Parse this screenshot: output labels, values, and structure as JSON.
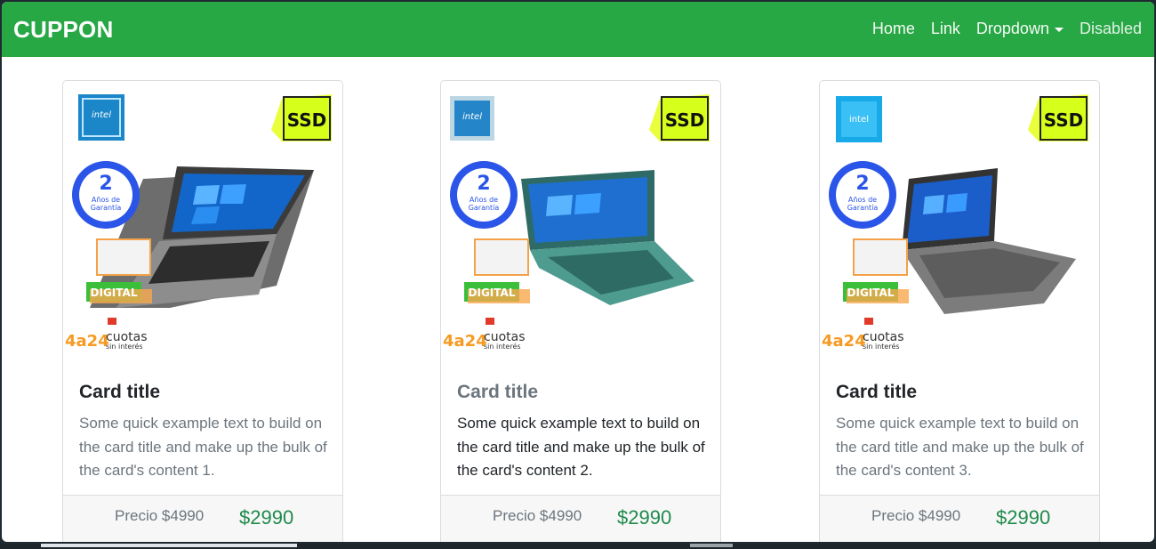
{
  "navbar": {
    "brand": "CUPPON",
    "links": [
      {
        "label": "Home"
      },
      {
        "label": "Link"
      },
      {
        "label": "Dropdown"
      },
      {
        "label": "Disabled"
      }
    ]
  },
  "colors": {
    "navbar": "#28a745",
    "price": "#1f8a4c",
    "muted_text": "#6c757d"
  },
  "cards": [
    {
      "badge_cpu": "intel",
      "badge_ssd": "SSD",
      "warranty_num": "2",
      "warranty_line1": "Años de",
      "warranty_line2": "Garantía",
      "digital": "DIGITAL",
      "cuotas_num": "4a24",
      "cuotas": "cuotas",
      "cuotas_sub": "sin interés",
      "title": "Card title",
      "text": "Some quick example text to build on the card title and make up the bulk of the card's content 1.",
      "price_old": "Precio $4990",
      "price_new": "$2990"
    },
    {
      "badge_cpu": "intel",
      "badge_ssd": "SSD",
      "warranty_num": "2",
      "warranty_line1": "Años de",
      "warranty_line2": "Garantía",
      "digital": "DIGITAL",
      "cuotas_num": "4a24",
      "cuotas": "cuotas",
      "cuotas_sub": "sin interés",
      "title": "Card title",
      "text": "Some quick example text to build on the card title and make up the bulk of the card's content 2.",
      "price_old": "Precio $4990",
      "price_new": "$2990"
    },
    {
      "badge_cpu": "intel",
      "badge_ssd": "SSD",
      "warranty_num": "2",
      "warranty_line1": "Años de",
      "warranty_line2": "Garantía",
      "digital": "DIGITAL",
      "cuotas_num": "4a24",
      "cuotas": "cuotas",
      "cuotas_sub": "sin interés",
      "title": "Card title",
      "text": "Some quick example text to build on the card title and make up the bulk of the card's content 3.",
      "price_old": "Precio $4990",
      "price_new": "$2990"
    }
  ]
}
